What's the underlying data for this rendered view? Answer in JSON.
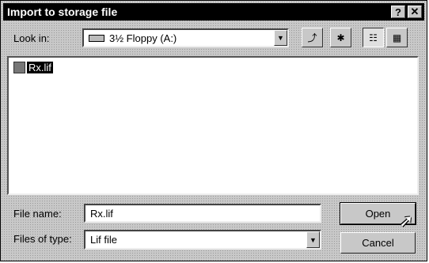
{
  "window": {
    "title": "Import to storage file",
    "help_label": "?",
    "close_label": "✕"
  },
  "look_in": {
    "label": "Look in:",
    "value": "3½ Floppy (A:)",
    "drive_icon": "floppy-drive-icon"
  },
  "toolbar": {
    "up_folder_icon": "up-folder-icon",
    "new_folder_icon": "new-folder-icon",
    "list_view_icon": "list-view-icon",
    "details_view_icon": "details-view-icon"
  },
  "files": [
    {
      "name": "Rx.lif",
      "selected": true,
      "icon": "lif-file-icon"
    }
  ],
  "file_name": {
    "label": "File name:",
    "value": "Rx.lif"
  },
  "files_of_type": {
    "label": "Files of type:",
    "value": "Lif file"
  },
  "buttons": {
    "open": "Open",
    "cancel": "Cancel"
  }
}
